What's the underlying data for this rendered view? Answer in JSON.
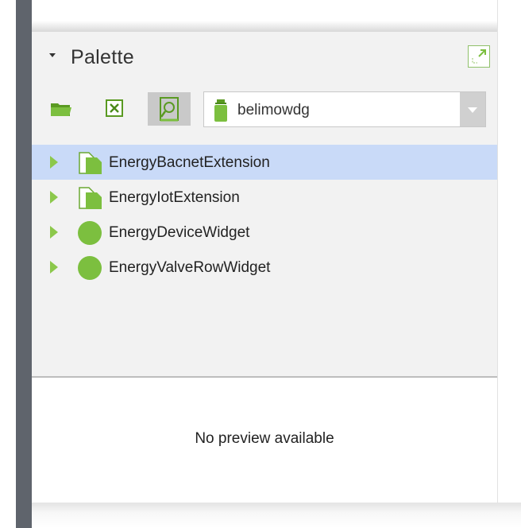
{
  "palette": {
    "title": "Palette",
    "collapse_icon": "caret-down-icon",
    "expand_icon": "maximize-icon"
  },
  "toolbar": {
    "open_icon": "folder-open-icon",
    "close_icon": "close-box-icon",
    "find_icon": "find-module-icon",
    "module_select": {
      "icon": "jar-icon",
      "value": "belimowdg"
    }
  },
  "tree": {
    "items": [
      {
        "label": "EnergyBacnetExtension",
        "icon": "component-type-icon",
        "selected": true
      },
      {
        "label": "EnergyIotExtension",
        "icon": "component-type-icon",
        "selected": false
      },
      {
        "label": "EnergyDeviceWidget",
        "icon": "widget-circle-icon",
        "selected": false
      },
      {
        "label": "EnergyValveRowWidget",
        "icon": "widget-circle-icon",
        "selected": false
      }
    ]
  },
  "preview": {
    "message": "No preview available"
  },
  "colors": {
    "accent_green": "#7cbf3f",
    "selection": "#c9daf8",
    "panel_bg": "#f2f2f2",
    "side_bar": "#5f646c"
  }
}
